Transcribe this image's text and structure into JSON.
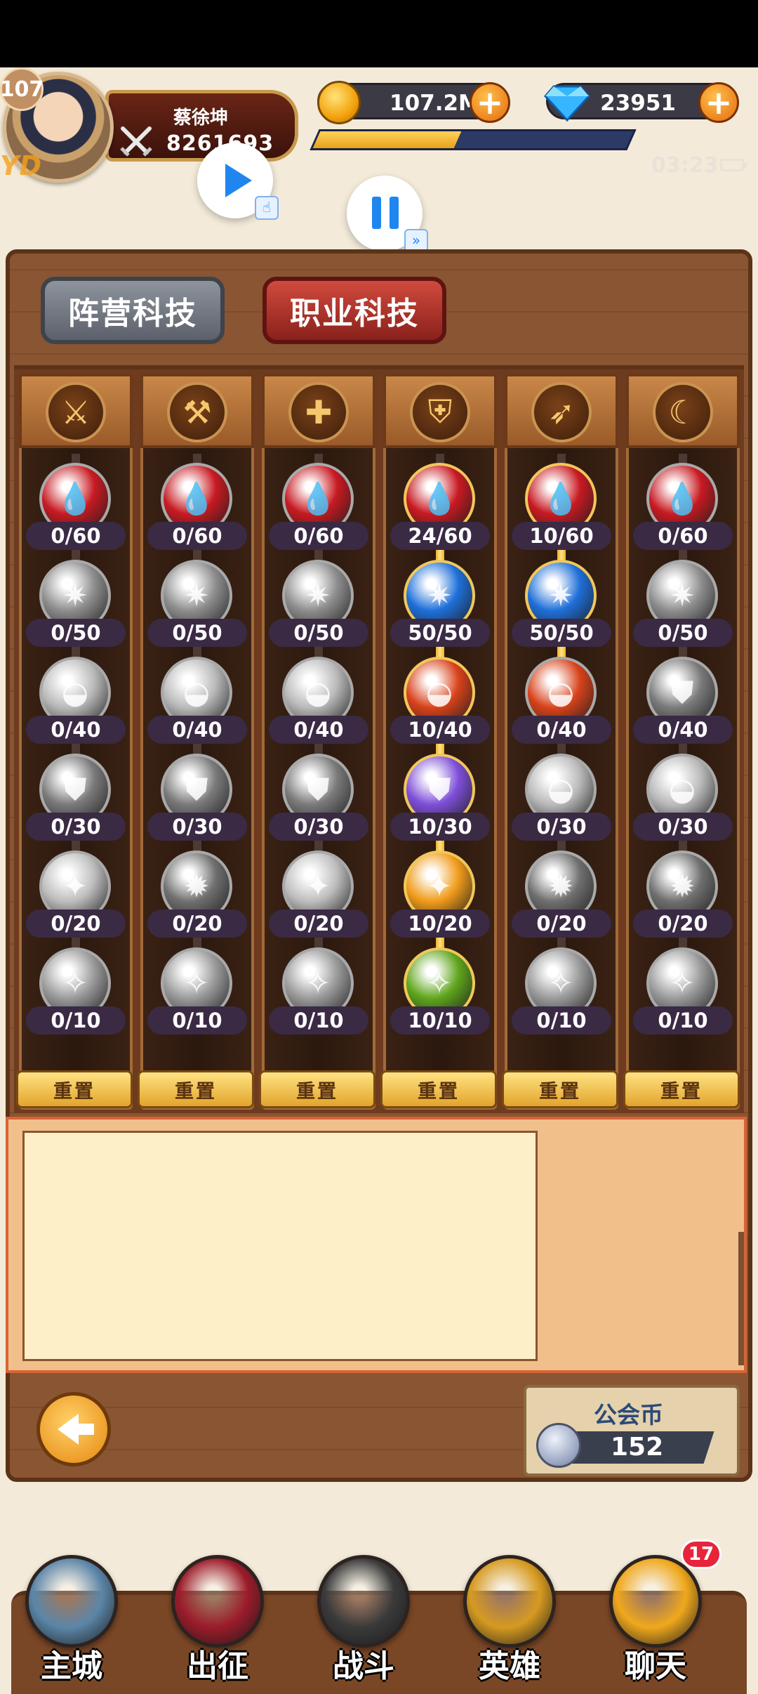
{
  "header": {
    "level": "107",
    "player_name": "蔡徐坤",
    "player_power": "8261693",
    "watermark": "YD",
    "gold": "107.2M",
    "gems": "23951",
    "exp_progress": 0.45,
    "time": "03:23"
  },
  "tabs": [
    {
      "label": "阵营科技",
      "active": false
    },
    {
      "label": "职业科技",
      "active": true
    }
  ],
  "columns": [
    {
      "class_icon": "sword-icon",
      "glyph": "⚔",
      "nodes": [
        {
          "value": "0/60",
          "color": "#c81a22",
          "glyph": "💧"
        },
        {
          "value": "0/50",
          "color": "#8d8d8d",
          "glyph": "✷"
        },
        {
          "value": "0/40",
          "color": "#b9b9b9",
          "glyph": "◒"
        },
        {
          "value": "0/30",
          "color": "#7a7a7a",
          "glyph": "⛊"
        },
        {
          "value": "0/20",
          "color": "#bdbdbd",
          "glyph": "✦"
        },
        {
          "value": "0/10",
          "color": "#9a9a9a",
          "glyph": "✧"
        }
      ],
      "lit_levels": 0
    },
    {
      "class_icon": "axe-icon",
      "glyph": "⚒",
      "nodes": [
        {
          "value": "0/60",
          "color": "#c81a22",
          "glyph": "💧"
        },
        {
          "value": "0/50",
          "color": "#8d8d8d",
          "glyph": "✷"
        },
        {
          "value": "0/40",
          "color": "#b9b9b9",
          "glyph": "◒"
        },
        {
          "value": "0/30",
          "color": "#7a7a7a",
          "glyph": "⛊"
        },
        {
          "value": "0/20",
          "color": "#6f6f6f",
          "glyph": "✹"
        },
        {
          "value": "0/10",
          "color": "#9a9a9a",
          "glyph": "✧"
        }
      ],
      "lit_levels": 0
    },
    {
      "class_icon": "cross-icon",
      "glyph": "✚",
      "nodes": [
        {
          "value": "0/60",
          "color": "#c81a22",
          "glyph": "💧"
        },
        {
          "value": "0/50",
          "color": "#8d8d8d",
          "glyph": "✷"
        },
        {
          "value": "0/40",
          "color": "#b9b9b9",
          "glyph": "◒"
        },
        {
          "value": "0/30",
          "color": "#7a7a7a",
          "glyph": "⛊"
        },
        {
          "value": "0/20",
          "color": "#bdbdbd",
          "glyph": "✦"
        },
        {
          "value": "0/10",
          "color": "#9a9a9a",
          "glyph": "✧"
        }
      ],
      "lit_levels": 0
    },
    {
      "class_icon": "shield-sword-icon",
      "glyph": "⛨",
      "nodes": [
        {
          "value": "24/60",
          "color": "#c81a22",
          "glyph": "💧"
        },
        {
          "value": "50/50",
          "color": "#1e6fd9",
          "glyph": "✷"
        },
        {
          "value": "10/40",
          "color": "#d8421b",
          "glyph": "◒"
        },
        {
          "value": "10/30",
          "color": "#7e4fd8",
          "glyph": "⛊"
        },
        {
          "value": "10/20",
          "color": "#f09b1a",
          "glyph": "✦"
        },
        {
          "value": "10/10",
          "color": "#5fa51c",
          "glyph": "✧"
        }
      ],
      "lit_levels": 6
    },
    {
      "class_icon": "bow-icon",
      "glyph": "➶",
      "nodes": [
        {
          "value": "10/60",
          "color": "#c81a22",
          "glyph": "💧"
        },
        {
          "value": "50/50",
          "color": "#1e6fd9",
          "glyph": "✷"
        },
        {
          "value": "0/40",
          "color": "#d8421b",
          "glyph": "◒"
        },
        {
          "value": "0/30",
          "color": "#b9b9b9",
          "glyph": "◒"
        },
        {
          "value": "0/20",
          "color": "#6f6f6f",
          "glyph": "✹"
        },
        {
          "value": "0/10",
          "color": "#9a9a9a",
          "glyph": "✧"
        }
      ],
      "lit_levels": 3
    },
    {
      "class_icon": "scimitar-icon",
      "glyph": "☾",
      "nodes": [
        {
          "value": "0/60",
          "color": "#c81a22",
          "glyph": "💧"
        },
        {
          "value": "0/50",
          "color": "#8d8d8d",
          "glyph": "✷"
        },
        {
          "value": "0/40",
          "color": "#7a7a7a",
          "glyph": "⛊"
        },
        {
          "value": "0/30",
          "color": "#b9b9b9",
          "glyph": "◒"
        },
        {
          "value": "0/20",
          "color": "#6f6f6f",
          "glyph": "✹"
        },
        {
          "value": "0/10",
          "color": "#9a9a9a",
          "glyph": "✧"
        }
      ],
      "lit_levels": 0
    }
  ],
  "reset_label": "重置",
  "guild": {
    "title": "公会币",
    "value": "152"
  },
  "nav": [
    {
      "label": "主城",
      "icon": "tower-icon",
      "color": "#5b86a8"
    },
    {
      "label": "出征",
      "icon": "crystal-icon",
      "color": "#9b1b2a"
    },
    {
      "label": "战斗",
      "icon": "battle-shield-icon",
      "color": "#3a3a3a"
    },
    {
      "label": "英雄",
      "icon": "crown-helmet-icon",
      "color": "#d69a20"
    },
    {
      "label": "聊天",
      "icon": "chat-icon",
      "color": "#f0a81c",
      "badge": "17"
    }
  ]
}
